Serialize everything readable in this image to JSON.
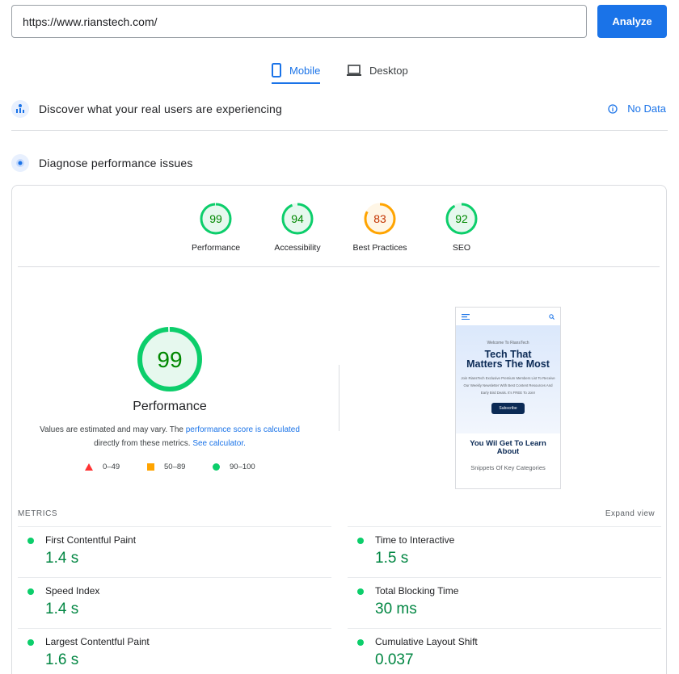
{
  "search": {
    "url": "https://www.rianstech.com/",
    "analyze_label": "Analyze"
  },
  "tabs": [
    {
      "label": "Mobile",
      "active": true
    },
    {
      "label": "Desktop",
      "active": false
    }
  ],
  "field_data": {
    "title": "Discover what your real users are experiencing",
    "status": "No Data"
  },
  "lab": {
    "title": "Diagnose performance issues"
  },
  "category_scores": [
    {
      "label": "Performance",
      "score": "99",
      "color": "#0cce6b",
      "text_color": "#008800"
    },
    {
      "label": "Accessibility",
      "score": "94",
      "color": "#0cce6b",
      "text_color": "#008800"
    },
    {
      "label": "Best Practices",
      "score": "83",
      "color": "#ffa400",
      "text_color": "#c33300"
    },
    {
      "label": "SEO",
      "score": "92",
      "color": "#0cce6b",
      "text_color": "#008800"
    }
  ],
  "main_score": {
    "score": "99",
    "label": "Performance",
    "disclaimer_pre": "Values are estimated and may vary. The ",
    "disclaimer_link": "performance score is calculated",
    "disclaimer_mid": "directly from these metrics. ",
    "calculator_link": "See calculator."
  },
  "legend": [
    {
      "range": "0–49",
      "shape": "triangle",
      "color": "#ff3333"
    },
    {
      "range": "50–89",
      "shape": "square",
      "color": "#ffa400"
    },
    {
      "range": "90–100",
      "shape": "circle",
      "color": "#0cce6b"
    }
  ],
  "screenshot": {
    "welcome": "Welcome To RiansTech",
    "headline_1": "Tech That",
    "headline_2": "Matters The Most",
    "body": "Join RiansTech Exclusive Premium Members List To Receive Our Weekly Newsletter With Best Content Resources And Early Bird Deals. It's FREE To Join!",
    "subscribe": "Subscribe",
    "learn_1": "You Wil Get To Learn",
    "learn_2": "About",
    "snippets": "Snippets Of Key Categories"
  },
  "metrics": {
    "label": "METRICS",
    "expand_label": "Expand view",
    "items": [
      {
        "name": "First Contentful Paint",
        "value": "1.4 s"
      },
      {
        "name": "Time to Interactive",
        "value": "1.5 s"
      },
      {
        "name": "Speed Index",
        "value": "1.4 s"
      },
      {
        "name": "Total Blocking Time",
        "value": "30 ms"
      },
      {
        "name": "Largest Contentful Paint",
        "value": "1.6 s"
      },
      {
        "name": "Cumulative Layout Shift",
        "value": "0.037"
      }
    ]
  }
}
